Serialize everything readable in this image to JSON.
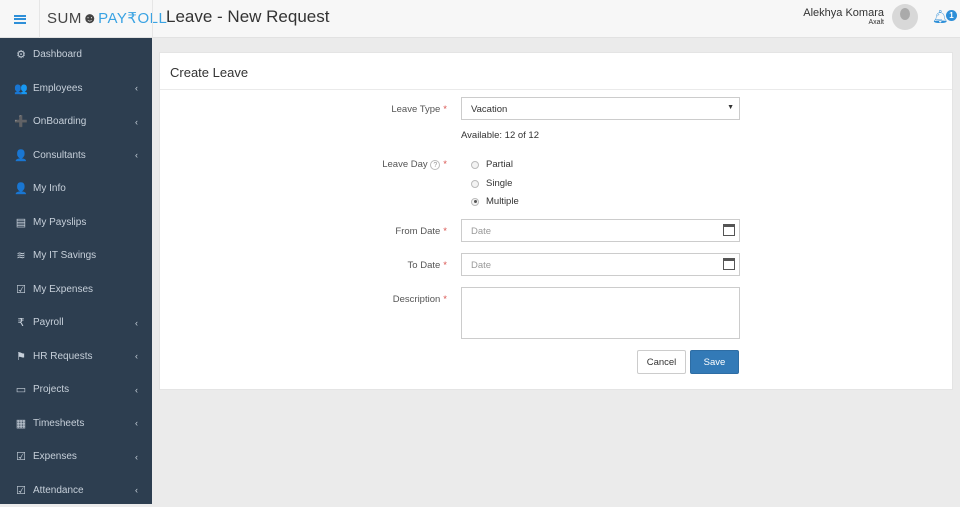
{
  "header": {
    "logo_left": "SUM",
    "logo_mid": "☻",
    "logo_right": "PAY₹OLL",
    "title": "Leave - New Request",
    "user_name": "Alekhya Komara",
    "company": "Axalt",
    "notifications": "1"
  },
  "sidebar": {
    "items": [
      {
        "label": "Dashboard",
        "icon": "⚙",
        "chev": false
      },
      {
        "label": "Employees",
        "icon": "👥",
        "chev": true
      },
      {
        "label": "OnBoarding",
        "icon": "➕",
        "chev": true
      },
      {
        "label": "Consultants",
        "icon": "👤",
        "chev": true
      },
      {
        "label": "My Info",
        "icon": "👤",
        "chev": false
      },
      {
        "label": "My Payslips",
        "icon": "▤",
        "chev": false
      },
      {
        "label": "My IT Savings",
        "icon": "≋",
        "chev": false
      },
      {
        "label": "My Expenses",
        "icon": "☑",
        "chev": false
      },
      {
        "label": "Payroll",
        "icon": "₹",
        "chev": true
      },
      {
        "label": "HR Requests",
        "icon": "⚑",
        "chev": true
      },
      {
        "label": "Projects",
        "icon": "▭",
        "chev": true
      },
      {
        "label": "Timesheets",
        "icon": "▦",
        "chev": true
      },
      {
        "label": "Expenses",
        "icon": "☑",
        "chev": true
      },
      {
        "label": "Attendance",
        "icon": "☑",
        "chev": true
      }
    ],
    "chev_glyph": "‹"
  },
  "form": {
    "title": "Create Leave",
    "leave_type_label": "Leave Type",
    "leave_type_value": "Vacation",
    "available": "Available: 12 of 12",
    "leave_day_label": "Leave Day",
    "help": "?",
    "options": [
      "Partial",
      "Single",
      "Multiple"
    ],
    "selected": "Multiple",
    "from_label": "From Date",
    "from_placeholder": "Date",
    "to_label": "To Date",
    "to_placeholder": "Date",
    "desc_label": "Description",
    "required": "*",
    "cancel": "Cancel",
    "save": "Save"
  }
}
